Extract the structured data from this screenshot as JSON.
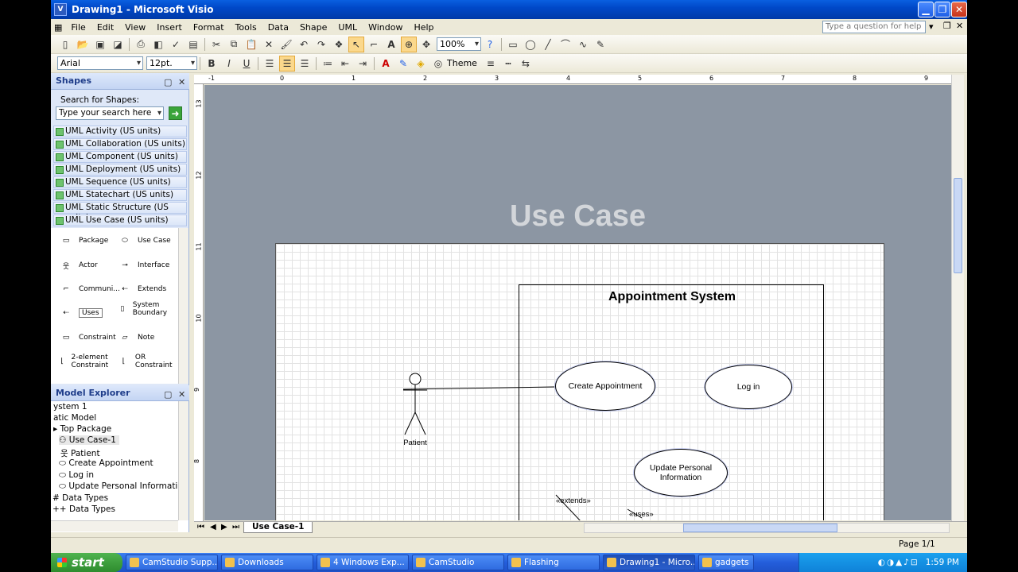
{
  "window": {
    "title": "Drawing1 - Microsoft Visio"
  },
  "menu": [
    "File",
    "Edit",
    "View",
    "Insert",
    "Format",
    "Tools",
    "Data",
    "Shape",
    "UML",
    "Window",
    "Help"
  ],
  "help_placeholder": "Type a question for help",
  "toolbar": {
    "zoom": "100%",
    "font": "Arial",
    "font_size": "12pt.",
    "theme_label": "Theme"
  },
  "shapes_pane": {
    "title": "Shapes",
    "search_label": "Search for Shapes:",
    "search_placeholder": "Type your search here",
    "stencils": [
      "UML Activity (US units)",
      "UML Collaboration (US units)",
      "UML Component (US units)",
      "UML Deployment (US units)",
      "UML Sequence (US units)",
      "UML Statechart (US units)",
      "UML Static Structure (US units)",
      "UML Use Case (US units)"
    ],
    "masters": [
      "Package",
      "Use Case",
      "Actor",
      "Interface",
      "Communi...",
      "Extends",
      "Uses",
      "System Boundary",
      "Constraint",
      "Note",
      "2-element Constraint",
      "OR Constraint"
    ]
  },
  "explorer": {
    "title": "Model Explorer",
    "items": [
      "ystem 1",
      "atic Model",
      "Top Package",
      "Use Case-1",
      "Patient",
      "Create Appointment",
      "Log in",
      "Update Personal Information",
      "Data Types",
      "Data Types"
    ]
  },
  "diagram": {
    "background_title": "Use Case",
    "system_title": "Appointment System",
    "actor": "Patient",
    "use_cases": [
      "Create Appointment",
      "Log in",
      "Update Personal Information"
    ],
    "extends_label": "«extends»",
    "uses_label": "«uses»"
  },
  "ruler_top": [
    "-1",
    "0",
    "1",
    "2",
    "3",
    "4",
    "5",
    "6",
    "7",
    "8",
    "9"
  ],
  "ruler_left": [
    "13",
    "12",
    "11",
    "10",
    "9",
    "8"
  ],
  "page_tab": "Use Case-1",
  "status": {
    "page": "Page 1/1"
  },
  "taskbar": {
    "start": "start",
    "tasks": [
      "CamStudio Supp...",
      "Downloads",
      "4 Windows Exp...",
      "CamStudio",
      "Flashing",
      "Drawing1 - Micro...",
      "gadgets"
    ],
    "clock": "1:59 PM"
  }
}
